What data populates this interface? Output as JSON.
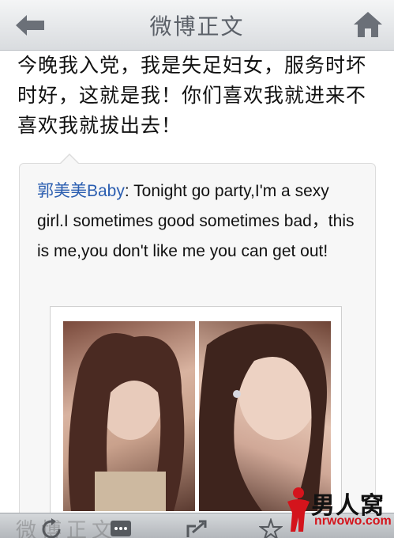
{
  "nav": {
    "title": "微博正文",
    "back_icon": "back-arrow-icon",
    "home_icon": "home-icon"
  },
  "post": {
    "text": "今晚我入党，我是失足妇女，服务时坏时好，这就是我！你们喜欢我就进来不喜欢我就拔出去！"
  },
  "quote": {
    "author": "郭美美Baby",
    "separator": ": ",
    "text": "Tonight go party,I'm a sexy girl.I sometimes good sometimes bad，this is me,you don't like me you can get out!"
  },
  "photos": [
    {
      "alt_icon": "photo-woman-left"
    },
    {
      "alt_icon": "photo-woman-right"
    }
  ],
  "toolbar": {
    "items": [
      "refresh-icon",
      "comment-icon",
      "share-icon",
      "favorite-star-icon"
    ]
  },
  "watermark": {
    "faded_text": "微博正文",
    "logo_cn": "男人窝",
    "logo_en": "nrwowo.com"
  },
  "colors": {
    "accent_link": "#2a5db0",
    "logo_red": "#d4141c"
  }
}
